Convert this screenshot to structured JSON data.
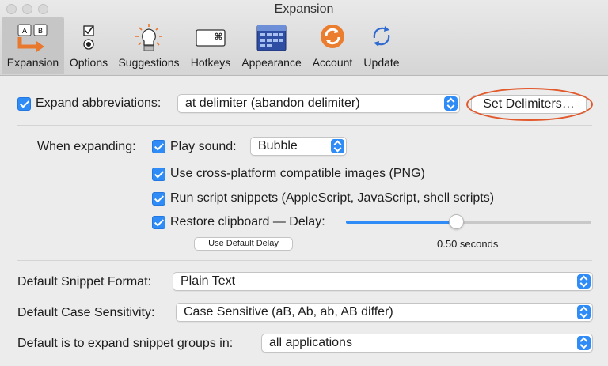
{
  "window": {
    "title": "Expansion"
  },
  "toolbar": {
    "items": [
      {
        "label": "Expansion",
        "selected": true
      },
      {
        "label": "Options"
      },
      {
        "label": "Suggestions"
      },
      {
        "label": "Hotkeys"
      },
      {
        "label": "Appearance"
      },
      {
        "label": "Account"
      },
      {
        "label": "Update"
      }
    ],
    "expansion_keys": [
      "A",
      "B"
    ],
    "hotkeys_glyph": "⌘"
  },
  "expand": {
    "label": "Expand abbreviations:",
    "checked": true,
    "mode": "at delimiter (abandon delimiter)",
    "delimiters_button": "Set Delimiters…"
  },
  "when_expanding": {
    "label": "When expanding:",
    "play_sound": {
      "label": "Play sound:",
      "checked": true,
      "value": "Bubble"
    },
    "png": {
      "label": "Use cross-platform compatible images (PNG)",
      "checked": true
    },
    "scripts": {
      "label": "Run script snippets (AppleScript, JavaScript, shell scripts)",
      "checked": true
    },
    "restore": {
      "label": "Restore clipboard — Delay:",
      "checked": true
    },
    "delay_fraction": 0.45,
    "default_delay_button": "Use Default Delay",
    "delay_value": "0.50 seconds"
  },
  "defaults": {
    "format": {
      "label": "Default Snippet Format:",
      "value": "Plain Text"
    },
    "case": {
      "label": "Default Case Sensitivity:",
      "value": "Case Sensitive (aB, Ab, ab, AB differ)"
    },
    "groups": {
      "label": "Default is to expand snippet groups in:",
      "value": "all applications"
    }
  },
  "colors": {
    "accent": "#2f8cf6",
    "highlight_ring": "#e2592c",
    "track_empty": "#c8c8c8"
  }
}
